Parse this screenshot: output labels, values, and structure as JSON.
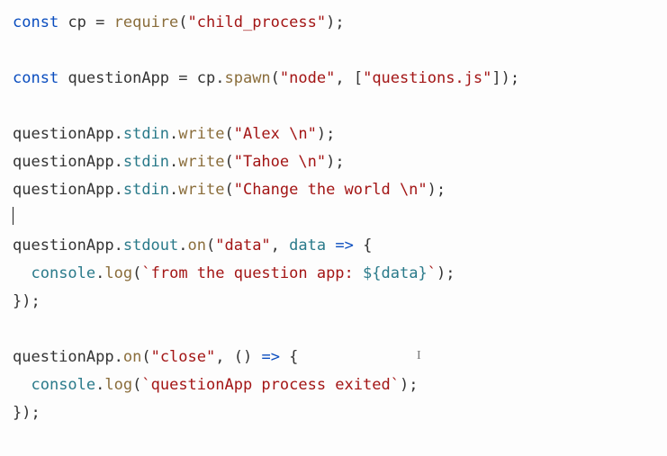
{
  "code": {
    "lines": [
      {
        "t": "decl",
        "kw": "const",
        "name": "cp",
        "assign": " = ",
        "call": "require",
        "open": "(",
        "str": "\"child_process\"",
        "close": ")",
        "end": ";"
      },
      {
        "t": "blank"
      },
      {
        "t": "decl2",
        "kw": "const",
        "name": "questionApp",
        "assign": " = ",
        "obj": "cp",
        "dot": ".",
        "method": "spawn",
        "open": "(",
        "arg1": "\"node\"",
        "comma": ", ",
        "arr_open": "[",
        "arg2": "\"questions.js\"",
        "arr_close": "]",
        "close": ")",
        "end": ";"
      },
      {
        "t": "blank"
      },
      {
        "t": "call3",
        "obj": "questionApp",
        "d1": ".",
        "p1": "stdin",
        "d2": ".",
        "m": "write",
        "open": "(",
        "str": "\"Alex \\n\"",
        "close": ")",
        "end": ";"
      },
      {
        "t": "call3",
        "obj": "questionApp",
        "d1": ".",
        "p1": "stdin",
        "d2": ".",
        "m": "write",
        "open": "(",
        "str": "\"Tahoe \\n\"",
        "close": ")",
        "end": ";"
      },
      {
        "t": "call3",
        "obj": "questionApp",
        "d1": ".",
        "p1": "stdin",
        "d2": ".",
        "m": "write",
        "open": "(",
        "str": "\"Change the world \\n\"",
        "close": ")",
        "end": ";"
      },
      {
        "t": "cursor"
      },
      {
        "t": "on1",
        "obj": "questionApp",
        "d1": ".",
        "p1": "stdout",
        "d2": ".",
        "m": "on",
        "open": "(",
        "evt": "\"data\"",
        "comma": ", ",
        "param": "data",
        "arrow": " => ",
        "brace": "{"
      },
      {
        "t": "log1",
        "indent": "  ",
        "obj": "console",
        "d1": ".",
        "m": "log",
        "open": "(",
        "bq1": "`",
        "tmpl_a": "from the question app: ",
        "int_o": "${",
        "int_v": "data",
        "int_c": "}",
        "bq2": "`",
        "close": ")",
        "end": ";"
      },
      {
        "t": "close",
        "text": "});"
      },
      {
        "t": "blank"
      },
      {
        "t": "on2",
        "obj": "questionApp",
        "d1": ".",
        "m": "on",
        "open": "(",
        "evt": "\"close\"",
        "comma": ", ",
        "paren_o": "(",
        "paren_c": ")",
        "arrow": " => ",
        "brace": "{"
      },
      {
        "t": "log2",
        "indent": "  ",
        "obj": "console",
        "d1": ".",
        "m": "log",
        "open": "(",
        "bq1": "`",
        "tmpl_a": "questionApp process exited",
        "bq2": "`",
        "close": ")",
        "end": ";"
      },
      {
        "t": "close",
        "text": "});"
      }
    ]
  },
  "cursor": {
    "ibeam_glyph": "I"
  }
}
